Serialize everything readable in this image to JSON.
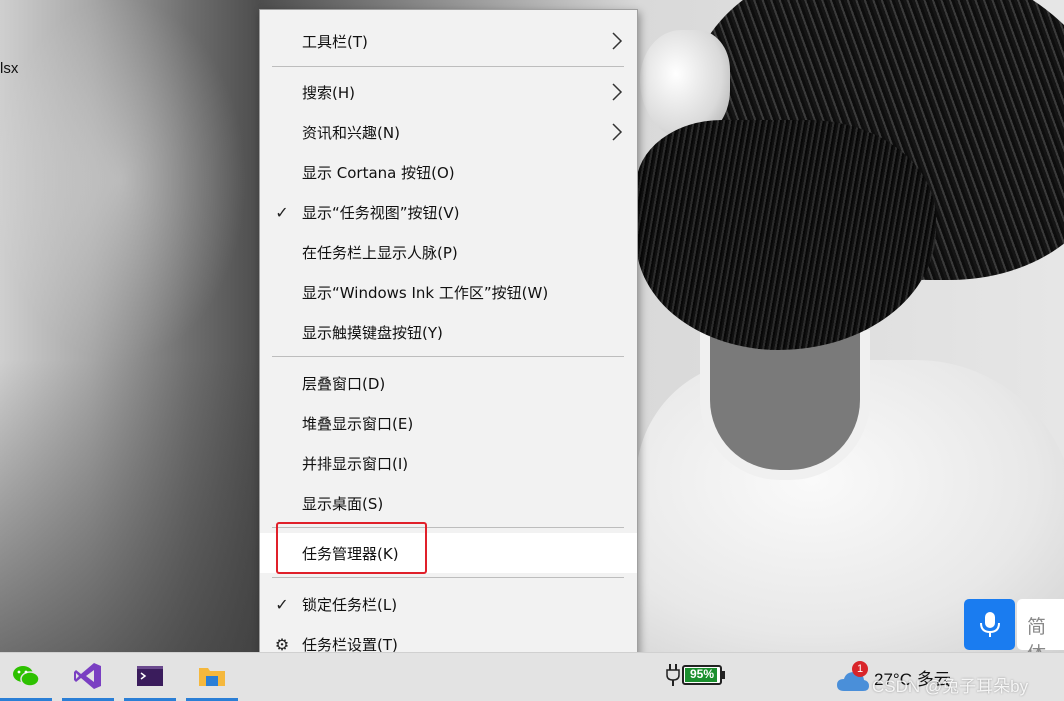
{
  "desktop": {
    "file_label": "lsx"
  },
  "context_menu": {
    "items": [
      {
        "label": "工具栏(T)",
        "submenu": true,
        "checked": false
      },
      {
        "label": "搜索(H)",
        "submenu": true,
        "checked": false
      },
      {
        "label": "资讯和兴趣(N)",
        "submenu": true,
        "checked": false
      },
      {
        "label": "显示 Cortana 按钮(O)",
        "submenu": false,
        "checked": false
      },
      {
        "label": "显示“任务视图”按钮(V)",
        "submenu": false,
        "checked": true
      },
      {
        "label": "在任务栏上显示人脉(P)",
        "submenu": false,
        "checked": false
      },
      {
        "label": "显示“Windows Ink 工作区”按钮(W)",
        "submenu": false,
        "checked": false
      },
      {
        "label": "显示触摸键盘按钮(Y)",
        "submenu": false,
        "checked": false
      },
      {
        "label": "层叠窗口(D)",
        "submenu": false,
        "checked": false
      },
      {
        "label": "堆叠显示窗口(E)",
        "submenu": false,
        "checked": false
      },
      {
        "label": "并排显示窗口(I)",
        "submenu": false,
        "checked": false
      },
      {
        "label": "显示桌面(S)",
        "submenu": false,
        "checked": false
      },
      {
        "label": "任务管理器(K)",
        "submenu": false,
        "checked": false,
        "highlighted": true
      },
      {
        "label": "锁定任务栏(L)",
        "submenu": false,
        "checked": true
      },
      {
        "label": "任务栏设置(T)",
        "submenu": false,
        "icon": "gear-icon"
      }
    ],
    "check_glyph": "✓",
    "gear_glyph": "⚙",
    "highlight_color": "#e0202a"
  },
  "ime": {
    "field_text": "简体"
  },
  "taskbar": {
    "apps": [
      "wechat-icon",
      "visual-studio-icon",
      "terminal-icon",
      "file-explorer-icon"
    ],
    "battery_percent": 95,
    "battery_label": "95%",
    "weather_badge": "1",
    "weather_text": "27°C 多云"
  },
  "watermark": "CSDN @兔子耳朵by"
}
